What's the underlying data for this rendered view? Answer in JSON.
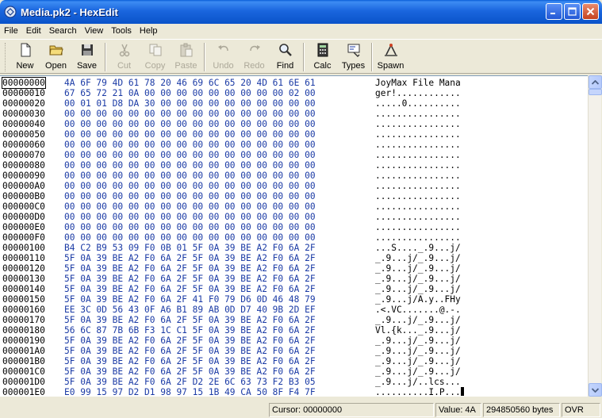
{
  "window": {
    "title": "Media.pk2 - HexEdit",
    "minimize_icon": "minimize-icon",
    "maximize_icon": "maximize-icon",
    "close_icon": "close-icon"
  },
  "menu": [
    "File",
    "Edit",
    "Search",
    "View",
    "Tools",
    "Help"
  ],
  "toolbar": [
    {
      "label": "New",
      "icon": "new-file-icon",
      "enabled": true
    },
    {
      "label": "Open",
      "icon": "open-folder-icon",
      "enabled": true
    },
    {
      "label": "Save",
      "icon": "save-disk-icon",
      "enabled": true
    },
    {
      "label": "Cut",
      "icon": "scissors-icon",
      "enabled": false
    },
    {
      "label": "Copy",
      "icon": "copy-icon",
      "enabled": false
    },
    {
      "label": "Paste",
      "icon": "paste-icon",
      "enabled": false
    },
    {
      "label": "Undo",
      "icon": "undo-icon",
      "enabled": false
    },
    {
      "label": "Redo",
      "icon": "redo-icon",
      "enabled": false
    },
    {
      "label": "Find",
      "icon": "magnifier-icon",
      "enabled": true
    },
    {
      "label": "Calc",
      "icon": "calculator-icon",
      "enabled": true
    },
    {
      "label": "Types",
      "icon": "types-icon",
      "enabled": true
    },
    {
      "label": "Spawn",
      "icon": "spawn-icon",
      "enabled": true
    }
  ],
  "hex_rows": [
    {
      "addr": "00000000",
      "bytes": "4A 6F 79 4D 61 78 20 46 69 6C 65 20 4D 61 6E 61",
      "ascii": "JoyMax File Mana"
    },
    {
      "addr": "00000010",
      "bytes": "67 65 72 21 0A 00 00 00 00 00 00 00 00 00 02 00",
      "ascii": "ger!............"
    },
    {
      "addr": "00000020",
      "bytes": "00 01 01 D8 DA 30 00 00 00 00 00 00 00 00 00 00",
      "ascii": ".....0.........."
    },
    {
      "addr": "00000030",
      "bytes": "00 00 00 00 00 00 00 00 00 00 00 00 00 00 00 00",
      "ascii": "................"
    },
    {
      "addr": "00000040",
      "bytes": "00 00 00 00 00 00 00 00 00 00 00 00 00 00 00 00",
      "ascii": "................"
    },
    {
      "addr": "00000050",
      "bytes": "00 00 00 00 00 00 00 00 00 00 00 00 00 00 00 00",
      "ascii": "................"
    },
    {
      "addr": "00000060",
      "bytes": "00 00 00 00 00 00 00 00 00 00 00 00 00 00 00 00",
      "ascii": "................"
    },
    {
      "addr": "00000070",
      "bytes": "00 00 00 00 00 00 00 00 00 00 00 00 00 00 00 00",
      "ascii": "................"
    },
    {
      "addr": "00000080",
      "bytes": "00 00 00 00 00 00 00 00 00 00 00 00 00 00 00 00",
      "ascii": "................"
    },
    {
      "addr": "00000090",
      "bytes": "00 00 00 00 00 00 00 00 00 00 00 00 00 00 00 00",
      "ascii": "................"
    },
    {
      "addr": "000000A0",
      "bytes": "00 00 00 00 00 00 00 00 00 00 00 00 00 00 00 00",
      "ascii": "................"
    },
    {
      "addr": "000000B0",
      "bytes": "00 00 00 00 00 00 00 00 00 00 00 00 00 00 00 00",
      "ascii": "................"
    },
    {
      "addr": "000000C0",
      "bytes": "00 00 00 00 00 00 00 00 00 00 00 00 00 00 00 00",
      "ascii": "................"
    },
    {
      "addr": "000000D0",
      "bytes": "00 00 00 00 00 00 00 00 00 00 00 00 00 00 00 00",
      "ascii": "................"
    },
    {
      "addr": "000000E0",
      "bytes": "00 00 00 00 00 00 00 00 00 00 00 00 00 00 00 00",
      "ascii": "................"
    },
    {
      "addr": "000000F0",
      "bytes": "00 00 00 00 00 00 00 00 00 00 00 00 00 00 00 00",
      "ascii": "................"
    },
    {
      "addr": "00000100",
      "bytes": "B4 C2 B9 53 09 F0 0B 01 5F 0A 39 BE A2 F0 6A 2F",
      "ascii": "...S...._.9...j/"
    },
    {
      "addr": "00000110",
      "bytes": "5F 0A 39 BE A2 F0 6A 2F 5F 0A 39 BE A2 F0 6A 2F",
      "ascii": "_.9...j/_.9...j/"
    },
    {
      "addr": "00000120",
      "bytes": "5F 0A 39 BE A2 F0 6A 2F 5F 0A 39 BE A2 F0 6A 2F",
      "ascii": "_.9...j/_.9...j/"
    },
    {
      "addr": "00000130",
      "bytes": "5F 0A 39 BE A2 F0 6A 2F 5F 0A 39 BE A2 F0 6A 2F",
      "ascii": "_.9...j/_.9...j/"
    },
    {
      "addr": "00000140",
      "bytes": "5F 0A 39 BE A2 F0 6A 2F 5F 0A 39 BE A2 F0 6A 2F",
      "ascii": "_.9...j/_.9...j/"
    },
    {
      "addr": "00000150",
      "bytes": "5F 0A 39 BE A2 F0 6A 2F 41 F0 79 D6 0D 46 48 79",
      "ascii": "_.9...j/A.y..FHy"
    },
    {
      "addr": "00000160",
      "bytes": "EE 3C 0D 56 43 0F A6 B1 89 AB 0D D7 40 9B 2D EF",
      "ascii": ".<.VC.......@.-."
    },
    {
      "addr": "00000170",
      "bytes": "5F 0A 39 BE A2 F0 6A 2F 5F 0A 39 BE A2 F0 6A 2F",
      "ascii": "_.9...j/_.9...j/"
    },
    {
      "addr": "00000180",
      "bytes": "56 6C 87 7B 6B F3 1C C1 5F 0A 39 BE A2 F0 6A 2F",
      "ascii": "Vl.{k..._.9...j/"
    },
    {
      "addr": "00000190",
      "bytes": "5F 0A 39 BE A2 F0 6A 2F 5F 0A 39 BE A2 F0 6A 2F",
      "ascii": "_.9...j/_.9...j/"
    },
    {
      "addr": "000001A0",
      "bytes": "5F 0A 39 BE A2 F0 6A 2F 5F 0A 39 BE A2 F0 6A 2F",
      "ascii": "_.9...j/_.9...j/"
    },
    {
      "addr": "000001B0",
      "bytes": "5F 0A 39 BE A2 F0 6A 2F 5F 0A 39 BE A2 F0 6A 2F",
      "ascii": "_.9...j/_.9...j/"
    },
    {
      "addr": "000001C0",
      "bytes": "5F 0A 39 BE A2 F0 6A 2F 5F 0A 39 BE A2 F0 6A 2F",
      "ascii": "_.9...j/_.9...j/"
    },
    {
      "addr": "000001D0",
      "bytes": "5F 0A 39 BE A2 F0 6A 2F D2 2E 6C 63 73 F2 B3 05",
      "ascii": "_.9...j/..lcs..."
    },
    {
      "addr": "000001E0",
      "bytes": "E0 99 15 97 D2 D1 98 97 15 1B 49 CA 50 8F F4 7F",
      "ascii": "..........I.P..."
    }
  ],
  "status": {
    "cursor": "Cursor: 00000000",
    "value": "Value: 4A",
    "size": "294850560 bytes",
    "mode": "OVR"
  },
  "colors": {
    "hex_bytes": "#1a3aa5",
    "title_bar": "#0a53c9"
  }
}
